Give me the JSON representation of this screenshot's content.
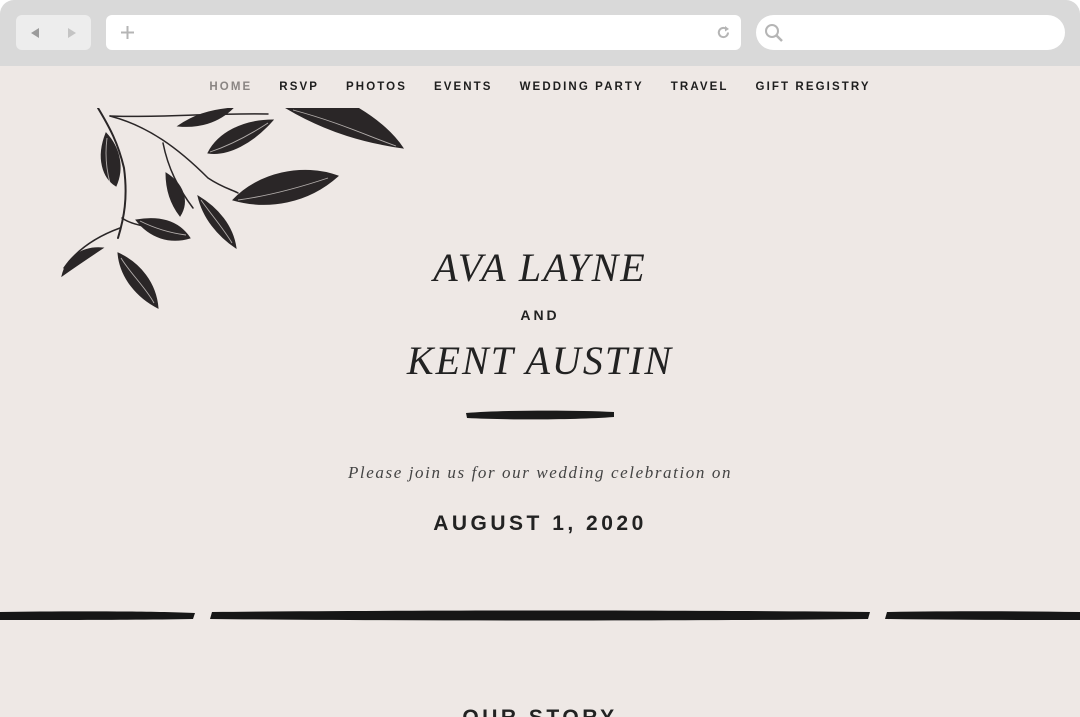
{
  "browser": {
    "back_icon": "back-arrow-icon",
    "forward_icon": "forward-arrow-icon",
    "new_tab_icon": "plus-icon",
    "reload_icon": "reload-icon",
    "search_icon": "search-icon",
    "address_value": "",
    "search_value": ""
  },
  "nav": {
    "items": [
      {
        "label": "HOME",
        "active": true
      },
      {
        "label": "RSVP",
        "active": false
      },
      {
        "label": "PHOTOS",
        "active": false
      },
      {
        "label": "EVENTS",
        "active": false
      },
      {
        "label": "WEDDING PARTY",
        "active": false
      },
      {
        "label": "TRAVEL",
        "active": false
      },
      {
        "label": "GIFT REGISTRY",
        "active": false
      }
    ]
  },
  "hero": {
    "name_one": "AVA LAYNE",
    "conjunction": "AND",
    "name_two": "KENT AUSTIN",
    "invitation": "Please join us for our wedding celebration on",
    "date": "AUGUST 1, 2020"
  },
  "sections": {
    "next_heading": "OUR STORY"
  },
  "colors": {
    "chrome": "#d9d9d9",
    "page_background": "#eee8e5",
    "ink": "#222222",
    "nav_active": "#8a8583"
  }
}
